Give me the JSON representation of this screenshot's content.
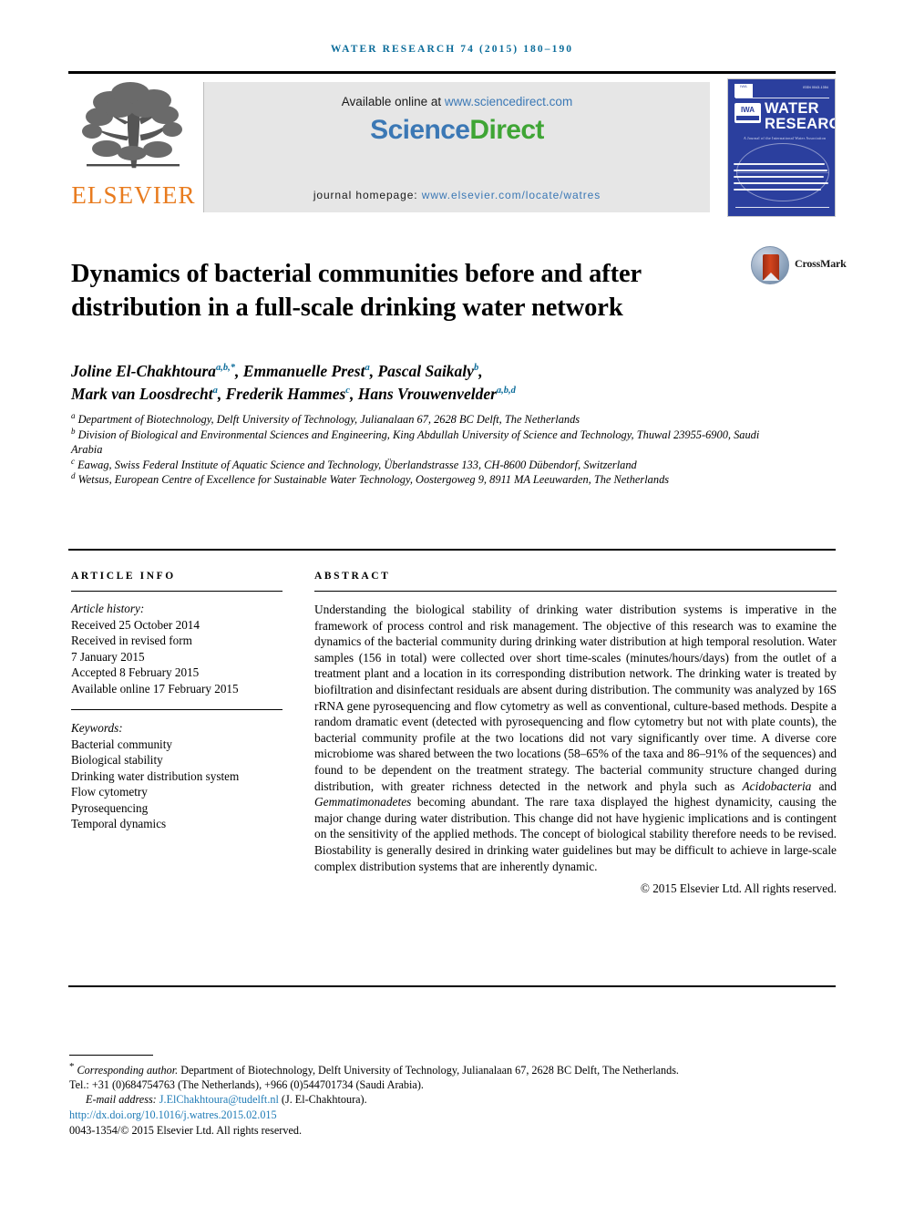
{
  "running_head": "Water Research 74 (2015) 180–190",
  "masthead": {
    "publisher_name": "ELSEVIER",
    "publisher_logo_alt": "elsevier-tree-logo",
    "available_prefix": "Available online at ",
    "available_url": "www.sciencedirect.com",
    "sciencedirect_part1": "Science",
    "sciencedirect_part2": "Direct",
    "homepage_prefix": "journal homepage: ",
    "homepage_url": "www.elsevier.com/locate/watres",
    "cover": {
      "title_line1": "WATER",
      "title_line2": "RESEARCH",
      "society_logo": "IWA",
      "subtitle": "A Journal of the International Water Association",
      "issn_note": "ISSN 0043-1354"
    }
  },
  "article": {
    "title": "Dynamics of bacterial communities before and after distribution in a full-scale drinking water network",
    "crossmark_label": "CrossMark",
    "authors": [
      {
        "name": "Joline El-Chakhtoura",
        "sup": "a,b,*"
      },
      {
        "name": "Emmanuelle Prest",
        "sup": "a"
      },
      {
        "name": "Pascal Saikaly",
        "sup": "b"
      },
      {
        "name": "Mark van Loosdrecht",
        "sup": "a"
      },
      {
        "name": "Frederik Hammes",
        "sup": "c"
      },
      {
        "name": "Hans Vrouwenvelder",
        "sup": "a,b,d"
      }
    ],
    "affiliations": [
      {
        "mark": "a",
        "text": "Department of Biotechnology, Delft University of Technology, Julianalaan 67, 2628 BC Delft, The Netherlands"
      },
      {
        "mark": "b",
        "text": "Division of Biological and Environmental Sciences and Engineering, King Abdullah University of Science and Technology, Thuwal 23955-6900, Saudi Arabia"
      },
      {
        "mark": "c",
        "text": "Eawag, Swiss Federal Institute of Aquatic Science and Technology, Überlandstrasse 133, CH-8600 Dübendorf, Switzerland"
      },
      {
        "mark": "d",
        "text": "Wetsus, European Centre of Excellence for Sustainable Water Technology, Oostergoweg 9, 8911 MA Leeuwarden, The Netherlands"
      }
    ]
  },
  "info": {
    "heading": "Article info",
    "history_label": "Article history:",
    "history": [
      "Received 25 October 2014",
      "Received in revised form",
      "7 January 2015",
      "Accepted 8 February 2015",
      "Available online 17 February 2015"
    ],
    "keywords_label": "Keywords:",
    "keywords": [
      "Bacterial community",
      "Biological stability",
      "Drinking water distribution system",
      "Flow cytometry",
      "Pyrosequencing",
      "Temporal dynamics"
    ]
  },
  "abstract": {
    "heading": "Abstract",
    "part1": "Understanding the biological stability of drinking water distribution systems is imperative in the framework of process control and risk management. The objective of this research was to examine the dynamics of the bacterial community during drinking water distribution at high temporal resolution. Water samples (156 in total) were collected over short time-scales (minutes/hours/days) from the outlet of a treatment plant and a location in its corresponding distribution network. The drinking water is treated by biofiltration and disinfectant residuals are absent during distribution. The community was analyzed by 16S rRNA gene pyrosequencing and flow cytometry as well as conventional, culture-based methods. Despite a random dramatic event (detected with pyrosequencing and flow cytometry but not with plate counts), the bacterial community profile at the two locations did not vary significantly over time. A diverse core microbiome was shared between the two locations (58–65% of the taxa and 86–91% of the sequences) and found to be dependent on the treatment strategy. The bacterial community structure changed during distribution, with greater richness detected in the network and phyla such as ",
    "italic1": "Acidobacteria",
    "part2": " and ",
    "italic2": "Gemmatimonadetes",
    "part3": " becoming abundant. The rare taxa displayed the highest dynamicity, causing the major change during water distribution. This change did not have hygienic implications and is contingent on the sensitivity of the applied methods. The concept of biological stability therefore needs to be revised. Biostability is generally desired in drinking water guidelines but may be difficult to achieve in large-scale complex distribution systems that are inherently dynamic.",
    "copyright": "© 2015 Elsevier Ltd. All rights reserved."
  },
  "footer": {
    "corresponding_marker": "*",
    "corresponding_label": "Corresponding author.",
    "corresponding_address": "Department of Biotechnology, Delft University of Technology, Julianalaan 67, 2628 BC Delft, The Netherlands.",
    "tel_line": "Tel.: +31 (0)684754763 (The Netherlands), +966 (0)544701734 (Saudi Arabia).",
    "email_label": "E-mail address:",
    "email": "J.ElChakhtoura@tudelft.nl",
    "email_owner": "(J. El-Chakhtoura).",
    "doi": "http://dx.doi.org/10.1016/j.watres.2015.02.015",
    "issn_line": "0043-1354/© 2015 Elsevier Ltd. All rights reserved."
  },
  "colors": {
    "running_head": "#0b6c9a",
    "link": "#3b78b5",
    "elsevier_orange": "#e87b1e",
    "sciencedirect_green": "#3fa535",
    "cover_blue": "#2b3f9e",
    "footer_link": "#1f7bb6"
  }
}
